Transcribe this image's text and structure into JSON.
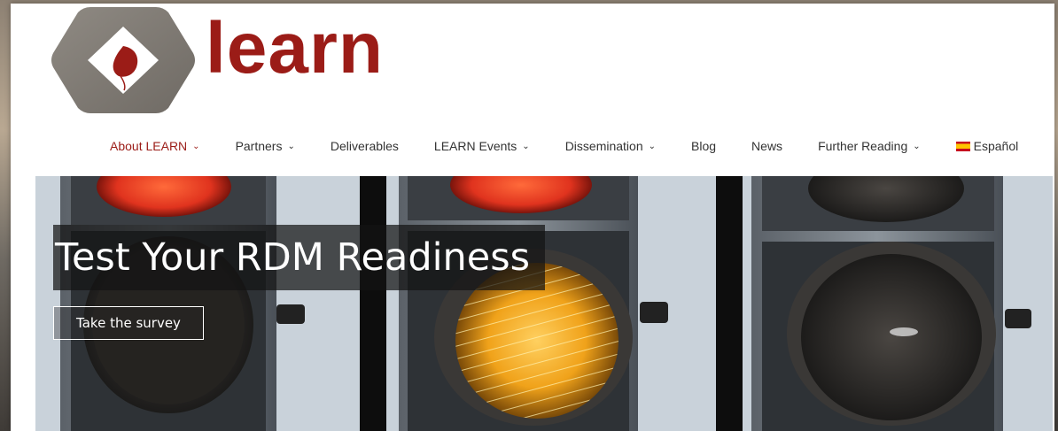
{
  "brand": {
    "name": "learn",
    "color": "#9b1c17",
    "logo_icon": "diamond-leaf-icon"
  },
  "nav": {
    "items": [
      {
        "label": "About LEARN",
        "dropdown": true,
        "active": true
      },
      {
        "label": "Partners",
        "dropdown": true
      },
      {
        "label": "Deliverables",
        "dropdown": false
      },
      {
        "label": "LEARN Events",
        "dropdown": true
      },
      {
        "label": "Dissemination",
        "dropdown": true
      },
      {
        "label": "Blog",
        "dropdown": false
      },
      {
        "label": "News",
        "dropdown": false
      },
      {
        "label": "Further Reading",
        "dropdown": true
      },
      {
        "label": "Español",
        "dropdown": false,
        "icon": "spain-flag-icon"
      }
    ],
    "chevron": "⌄"
  },
  "hero": {
    "title": "Test Your RDM Readiness",
    "button_label": "Take the survey",
    "image": "traffic-lights-image"
  },
  "colors": {
    "accent": "#9b1c17",
    "nav_text": "#333333",
    "red_light": "#e0331e",
    "amber_light": "#f0a21a"
  }
}
